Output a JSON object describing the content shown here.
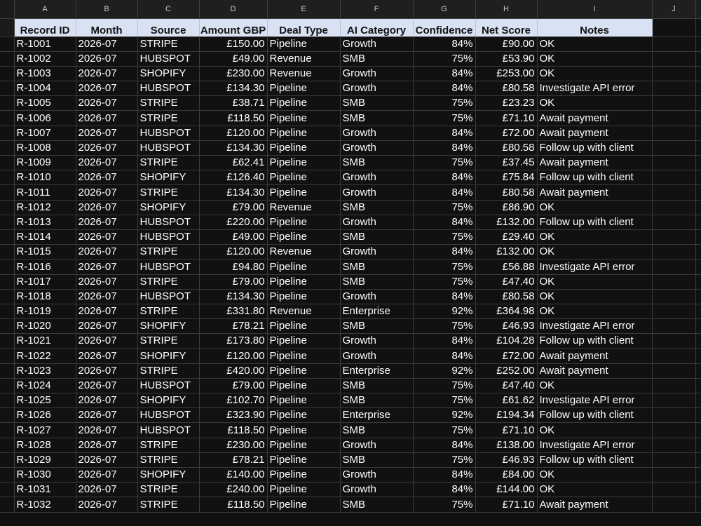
{
  "columns": [
    "A",
    "B",
    "C",
    "D",
    "E",
    "F",
    "G",
    "H",
    "I",
    "J"
  ],
  "headers": [
    "Record ID",
    "Month",
    "Source",
    "Amount GBP",
    "Deal Type",
    "AI Category",
    "Confidence",
    "Net Score",
    "Notes"
  ],
  "rows": [
    [
      "R-1001",
      "2026-07",
      "STRIPE",
      "£150.00",
      "Pipeline",
      "Growth",
      "84%",
      "£90.00",
      "OK"
    ],
    [
      "R-1002",
      "2026-07",
      "HUBSPOT",
      "£49.00",
      "Revenue",
      "SMB",
      "75%",
      "£53.90",
      "OK"
    ],
    [
      "R-1003",
      "2026-07",
      "SHOPIFY",
      "£230.00",
      "Revenue",
      "Growth",
      "84%",
      "£253.00",
      "OK"
    ],
    [
      "R-1004",
      "2026-07",
      "HUBSPOT",
      "£134.30",
      "Pipeline",
      "Growth",
      "84%",
      "£80.58",
      "Investigate API error"
    ],
    [
      "R-1005",
      "2026-07",
      "STRIPE",
      "£38.71",
      "Pipeline",
      "SMB",
      "75%",
      "£23.23",
      "OK"
    ],
    [
      "R-1006",
      "2026-07",
      "STRIPE",
      "£118.50",
      "Pipeline",
      "SMB",
      "75%",
      "£71.10",
      "Await payment"
    ],
    [
      "R-1007",
      "2026-07",
      "HUBSPOT",
      "£120.00",
      "Pipeline",
      "Growth",
      "84%",
      "£72.00",
      "Await payment"
    ],
    [
      "R-1008",
      "2026-07",
      "HUBSPOT",
      "£134.30",
      "Pipeline",
      "Growth",
      "84%",
      "£80.58",
      "Follow up with client"
    ],
    [
      "R-1009",
      "2026-07",
      "STRIPE",
      "£62.41",
      "Pipeline",
      "SMB",
      "75%",
      "£37.45",
      "Await payment"
    ],
    [
      "R-1010",
      "2026-07",
      "SHOPIFY",
      "£126.40",
      "Pipeline",
      "Growth",
      "84%",
      "£75.84",
      "Follow up with client"
    ],
    [
      "R-1011",
      "2026-07",
      "STRIPE",
      "£134.30",
      "Pipeline",
      "Growth",
      "84%",
      "£80.58",
      "Await payment"
    ],
    [
      "R-1012",
      "2026-07",
      "SHOPIFY",
      "£79.00",
      "Revenue",
      "SMB",
      "75%",
      "£86.90",
      "OK"
    ],
    [
      "R-1013",
      "2026-07",
      "HUBSPOT",
      "£220.00",
      "Pipeline",
      "Growth",
      "84%",
      "£132.00",
      "Follow up with client"
    ],
    [
      "R-1014",
      "2026-07",
      "HUBSPOT",
      "£49.00",
      "Pipeline",
      "SMB",
      "75%",
      "£29.40",
      "OK"
    ],
    [
      "R-1015",
      "2026-07",
      "STRIPE",
      "£120.00",
      "Revenue",
      "Growth",
      "84%",
      "£132.00",
      "OK"
    ],
    [
      "R-1016",
      "2026-07",
      "HUBSPOT",
      "£94.80",
      "Pipeline",
      "SMB",
      "75%",
      "£56.88",
      "Investigate API error"
    ],
    [
      "R-1017",
      "2026-07",
      "STRIPE",
      "£79.00",
      "Pipeline",
      "SMB",
      "75%",
      "£47.40",
      "OK"
    ],
    [
      "R-1018",
      "2026-07",
      "HUBSPOT",
      "£134.30",
      "Pipeline",
      "Growth",
      "84%",
      "£80.58",
      "OK"
    ],
    [
      "R-1019",
      "2026-07",
      "STRIPE",
      "£331.80",
      "Revenue",
      "Enterprise",
      "92%",
      "£364.98",
      "OK"
    ],
    [
      "R-1020",
      "2026-07",
      "SHOPIFY",
      "£78.21",
      "Pipeline",
      "SMB",
      "75%",
      "£46.93",
      "Investigate API error"
    ],
    [
      "R-1021",
      "2026-07",
      "STRIPE",
      "£173.80",
      "Pipeline",
      "Growth",
      "84%",
      "£104.28",
      "Follow up with client"
    ],
    [
      "R-1022",
      "2026-07",
      "SHOPIFY",
      "£120.00",
      "Pipeline",
      "Growth",
      "84%",
      "£72.00",
      "Await payment"
    ],
    [
      "R-1023",
      "2026-07",
      "STRIPE",
      "£420.00",
      "Pipeline",
      "Enterprise",
      "92%",
      "£252.00",
      "Await payment"
    ],
    [
      "R-1024",
      "2026-07",
      "HUBSPOT",
      "£79.00",
      "Pipeline",
      "SMB",
      "75%",
      "£47.40",
      "OK"
    ],
    [
      "R-1025",
      "2026-07",
      "SHOPIFY",
      "£102.70",
      "Pipeline",
      "SMB",
      "75%",
      "£61.62",
      "Investigate API error"
    ],
    [
      "R-1026",
      "2026-07",
      "HUBSPOT",
      "£323.90",
      "Pipeline",
      "Enterprise",
      "92%",
      "£194.34",
      "Follow up with client"
    ],
    [
      "R-1027",
      "2026-07",
      "HUBSPOT",
      "£118.50",
      "Pipeline",
      "SMB",
      "75%",
      "£71.10",
      "OK"
    ],
    [
      "R-1028",
      "2026-07",
      "STRIPE",
      "£230.00",
      "Pipeline",
      "Growth",
      "84%",
      "£138.00",
      "Investigate API error"
    ],
    [
      "R-1029",
      "2026-07",
      "STRIPE",
      "£78.21",
      "Pipeline",
      "SMB",
      "75%",
      "£46.93",
      "Follow up with client"
    ],
    [
      "R-1030",
      "2026-07",
      "SHOPIFY",
      "£140.00",
      "Pipeline",
      "Growth",
      "84%",
      "£84.00",
      "OK"
    ],
    [
      "R-1031",
      "2026-07",
      "STRIPE",
      "£240.00",
      "Pipeline",
      "Growth",
      "84%",
      "£144.00",
      "OK"
    ],
    [
      "R-1032",
      "2026-07",
      "STRIPE",
      "£118.50",
      "Pipeline",
      "SMB",
      "75%",
      "£71.10",
      "Await payment"
    ]
  ],
  "colors": {
    "background": "#111111",
    "header_fill": "#d9e2f3",
    "grid_line": "#3a3a3a",
    "text": "#ffffff"
  }
}
